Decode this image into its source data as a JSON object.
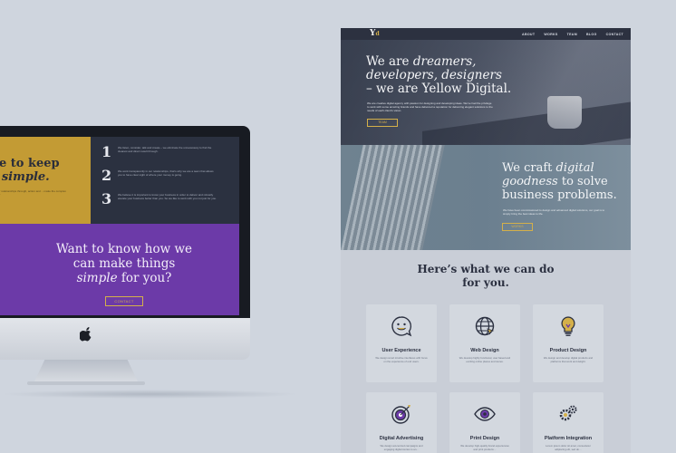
{
  "imac": {
    "yellow_heading_line1": "ke to keep",
    "yellow_heading_line2_prefix": "s ",
    "yellow_heading_line2_em": "simple.",
    "yellow_tiny_text": "…in our relationships through, action and …make the complex simple?",
    "steps": [
      {
        "number": "1",
        "text": "We listen, consider, talk and create – we eliminate the unnecessary to find the clearest and direct result through."
      },
      {
        "number": "2",
        "text": "We work transparently in our relationships, that’s why we are a team that allows you to have clear sight of where your money is going."
      },
      {
        "number": "3",
        "text": "We believe it is important to know your business in order to deliver and robustly elevate your business better than you. So we like to work with you not just for you."
      }
    ],
    "cta_line1": "Want to know how we",
    "cta_line2": "can make things",
    "cta_line3_em": "simple",
    "cta_line3_rest": " for you?",
    "contact_button": "CONTACT"
  },
  "site": {
    "logo_main": "Y",
    "logo_sub": "d",
    "nav": [
      "ABOUT",
      "WORKS",
      "TEAM",
      "BLOG",
      "CONTACT"
    ],
    "hero": {
      "line1_prefix": "We are ",
      "line1_em": "dreamers,",
      "line2_em": "developers, designers",
      "line3": "– we are Yellow Digital.",
      "paragraph": "We are creative digital agency with passion for designing and developing ideas. We’ve had the privilege to work with some amazing brands and have delivered a reputation for delivering elegant solutions to the needs of each client’s vision.",
      "button": "TEAM"
    },
    "craft": {
      "line1_prefix": "We craft ",
      "line1_em": "digital",
      "line2_em": "goodness",
      "line2_rest": " to solve",
      "line3": "business problems.",
      "paragraph": "We have been commissioned to design and advanced digital solutions, our goal is to simply bring the best ideas to life.",
      "button": "WORKS"
    },
    "services_title_line1": "Here’s what we can do",
    "services_title_line2": "for you.",
    "services": [
      {
        "icon": "smiley-chat-icon",
        "title": "User Experience",
        "desc": "We design smart intuitive interfaces with focus on the experience of end users."
      },
      {
        "icon": "globe-icon",
        "title": "Web Design",
        "desc": "We develop highly functional, user based and exciting online places and stores."
      },
      {
        "icon": "lightbulb-icon",
        "title": "Product Design",
        "desc": "We design and develop digital products and platforms that work and delight."
      },
      {
        "icon": "target-icon",
        "title": "Digital Advertising",
        "desc": "We design ad-centred campaigns and engaging digital stories to an…"
      },
      {
        "icon": "eye-icon",
        "title": "Print Design",
        "desc": "We develop high-quality brand experiences and print products…"
      },
      {
        "icon": "gears-icon",
        "title": "Platform Integration",
        "desc": "Lorem ipsum dolor sit amet, consectetur adipiscing elit, sed do…"
      }
    ]
  },
  "colors": {
    "background": "#cfd5de",
    "yellow": "#c39b34",
    "purple": "#6c3aa8",
    "navy": "#2c3140",
    "accent_gold": "#d4b04a"
  }
}
